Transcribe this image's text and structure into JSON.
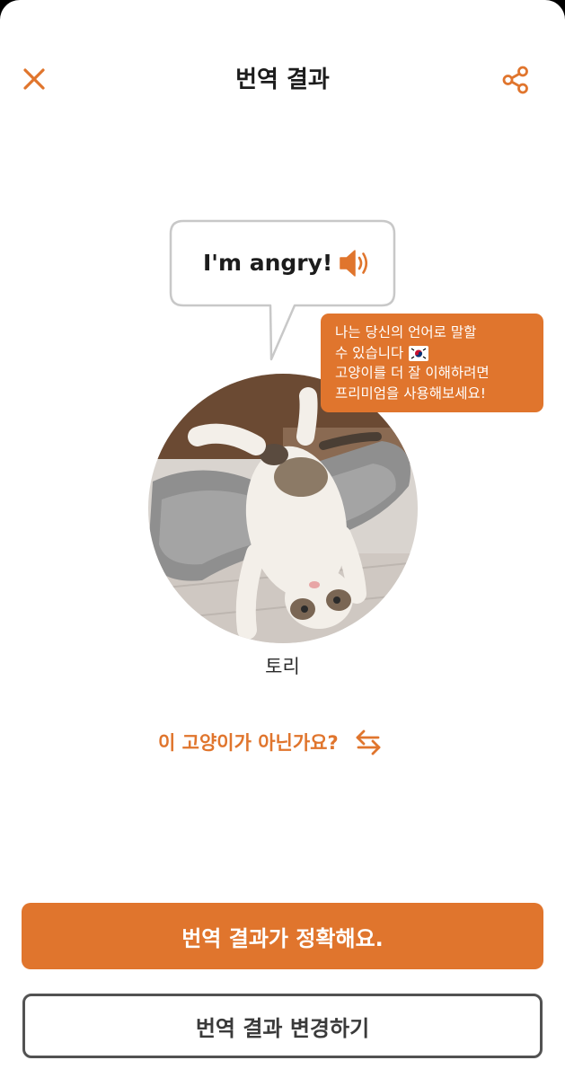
{
  "header": {
    "title": "번역 결과",
    "close_icon": "close-x-icon",
    "share_icon": "share-icon"
  },
  "translation": {
    "text": "I'm angry!",
    "speaker_icon": "speaker-volume-icon"
  },
  "promo": {
    "line1": "나는 당신의 언어로 말할",
    "line2": "수 있습니다",
    "line3": "고양이를 더 잘 이해하려면",
    "line4": "프리미엄을 사용해보세요!",
    "flag_icon": "korea-flag-icon"
  },
  "cat": {
    "name": "토리"
  },
  "not_this_cat": {
    "label": "이 고양이가 아닌가요?",
    "icon": "swap-arrows-icon"
  },
  "actions": {
    "confirm_label": "번역 결과가 정확해요.",
    "change_label": "번역 결과 변경하기"
  },
  "colors": {
    "accent": "#e0752d",
    "text": "#1c1c1c",
    "outline": "#525252",
    "bubble_border": "#c8c8c8"
  }
}
